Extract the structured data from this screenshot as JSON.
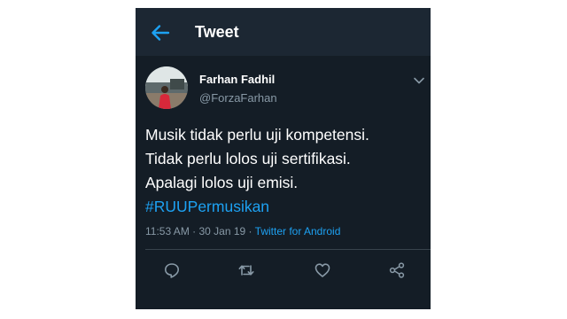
{
  "appbar": {
    "title": "Tweet",
    "back_icon": "arrow-left-icon"
  },
  "tweet": {
    "author": {
      "display_name": "Farhan Fadhil",
      "handle": "@ForzaFarhan"
    },
    "menu_icon": "chevron-down-icon",
    "text_lines": [
      "Musik tidak perlu uji kompetensi.",
      "Tidak perlu lolos uji sertifikasi.",
      "Apalagi lolos uji emisi."
    ],
    "hashtag": "#RUUPermusikan",
    "time": "11:53 AM",
    "separator": " · ",
    "date": "30 Jan 19",
    "source": "Twitter for Android"
  },
  "actions": [
    {
      "name": "reply",
      "icon": "reply-icon"
    },
    {
      "name": "retweet",
      "icon": "retweet-icon"
    },
    {
      "name": "like",
      "icon": "heart-icon"
    },
    {
      "name": "share",
      "icon": "share-icon"
    }
  ],
  "colors": {
    "background": "#141d26",
    "appbar": "#1c2733",
    "accent": "#1da1f2",
    "secondary_text": "#8899a6",
    "divider": "#38444d"
  }
}
